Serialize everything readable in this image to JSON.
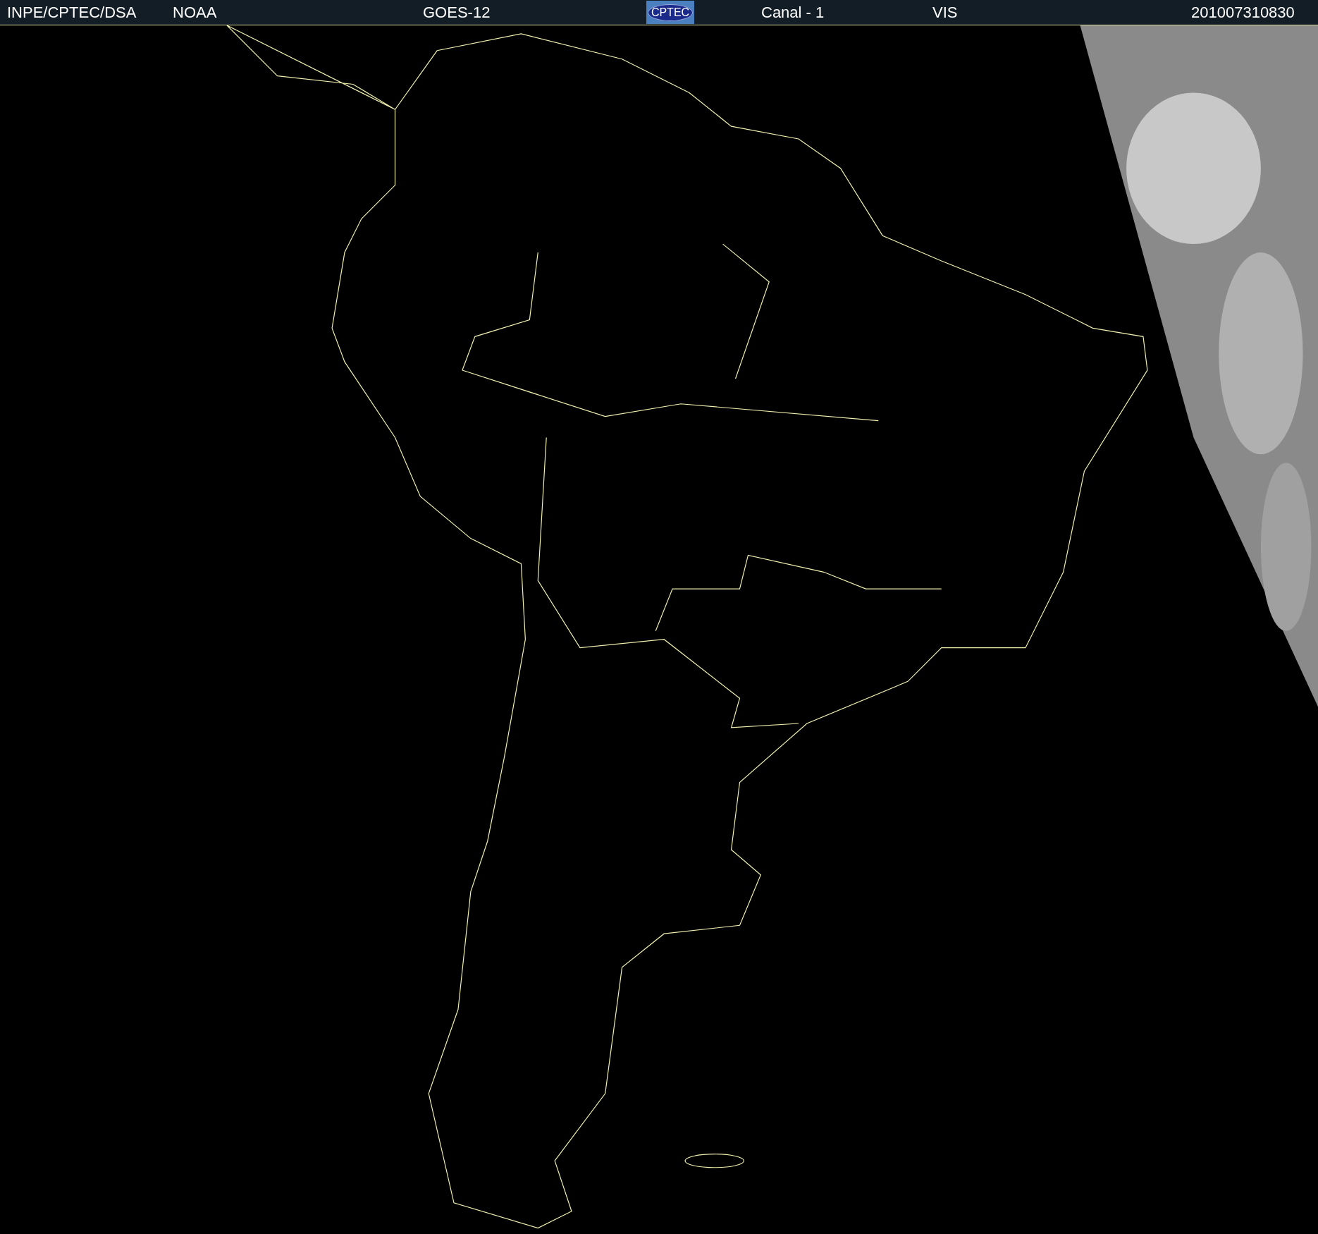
{
  "header": {
    "items": [
      {
        "kind": "text",
        "text": "INPE/CPTEC/DSA"
      },
      {
        "kind": "text",
        "text": "NOAA"
      },
      {
        "kind": "text",
        "text": "GOES-12"
      },
      {
        "kind": "logo",
        "text": "CPTEC"
      },
      {
        "kind": "text",
        "text": "Canal - 1"
      },
      {
        "kind": "text",
        "text": "VIS"
      },
      {
        "kind": "text",
        "text": "201007310830"
      }
    ]
  }
}
